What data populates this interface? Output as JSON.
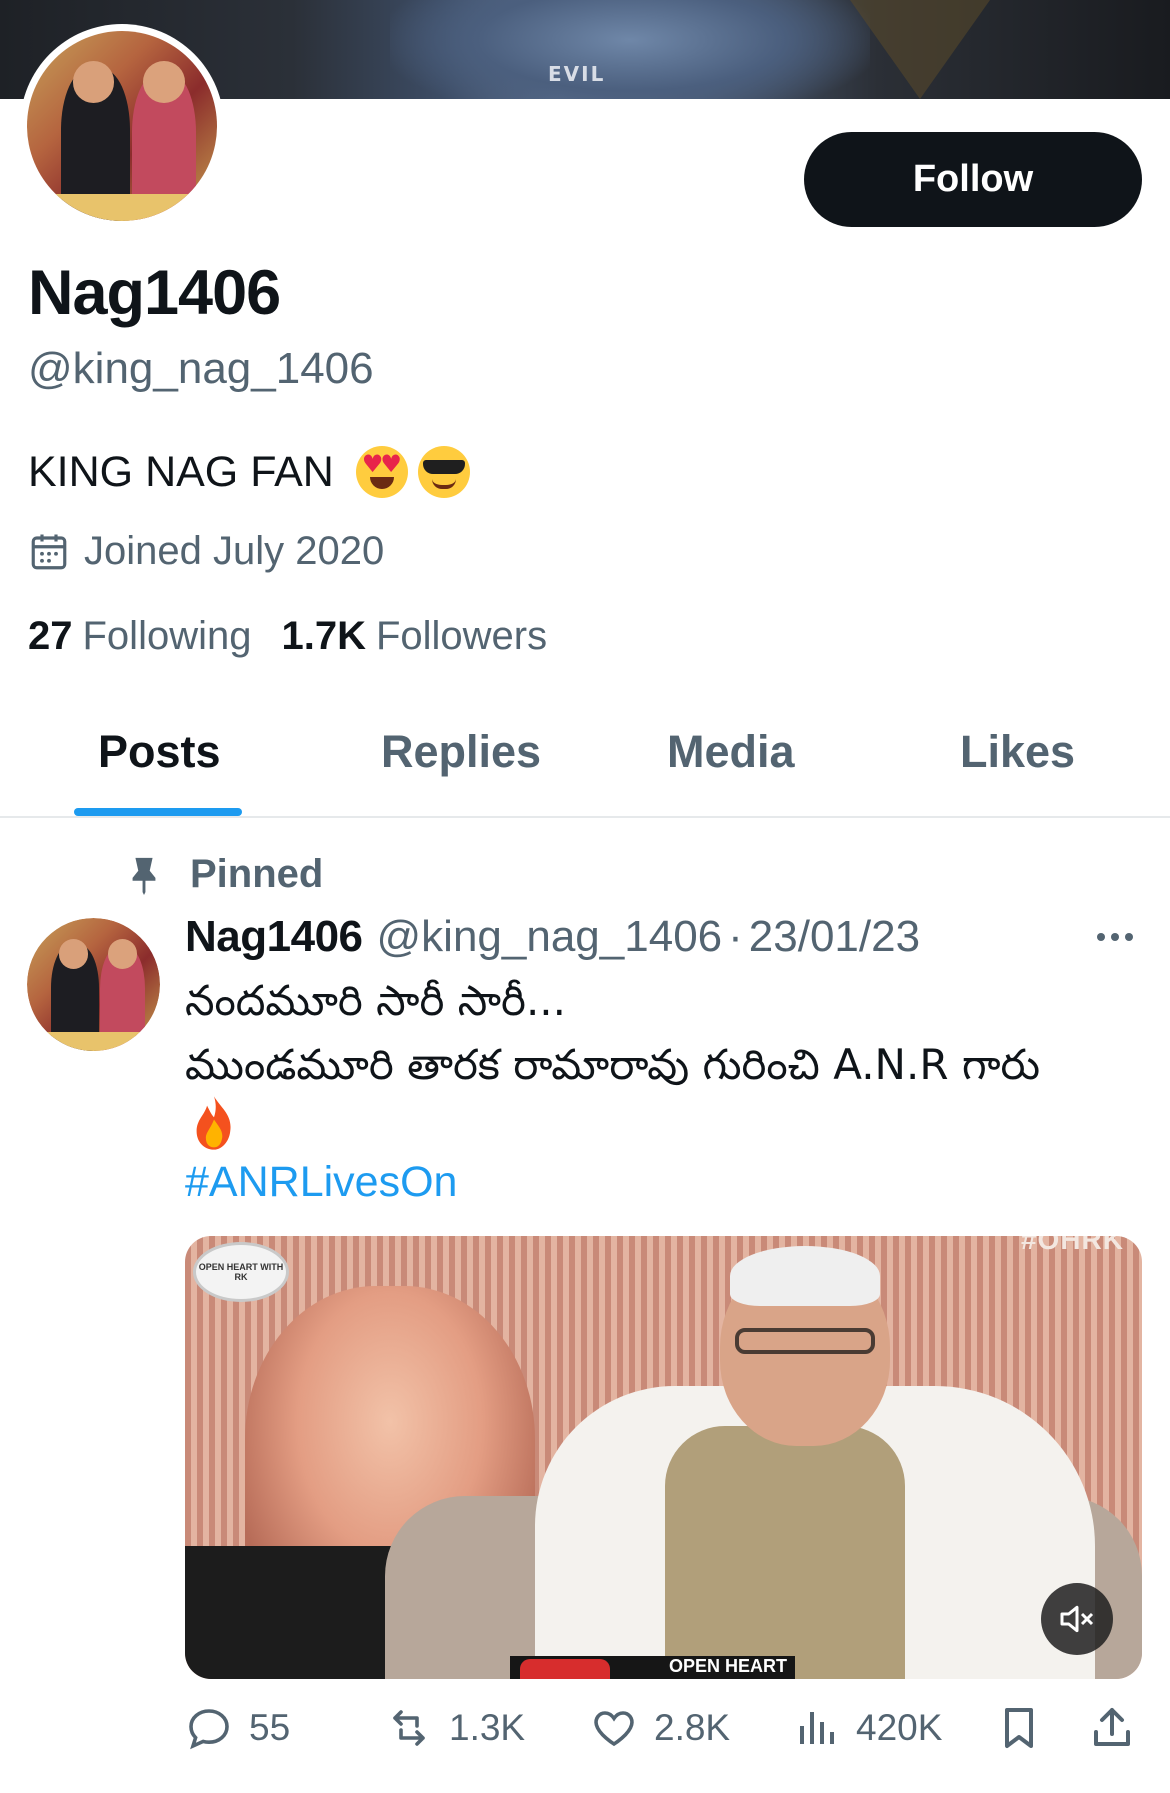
{
  "banner": {
    "text": "EVIL"
  },
  "profile": {
    "display_name": "Nag1406",
    "handle": "@king_nag_1406",
    "bio": "KING NAG FAN",
    "bio_emojis": [
      "heart-eyes-emoji",
      "sunglasses-emoji"
    ],
    "joined": "Joined July 2020",
    "following_count": "27",
    "following_label": "Following",
    "followers_count": "1.7K",
    "followers_label": "Followers",
    "follow_button": "Follow"
  },
  "tabs": [
    {
      "label": "Posts",
      "active": true
    },
    {
      "label": "Replies",
      "active": false
    },
    {
      "label": "Media",
      "active": false
    },
    {
      "label": "Likes",
      "active": false
    }
  ],
  "post": {
    "pinned_label": "Pinned",
    "author_name": "Nag1406",
    "author_handle": "@king_nag_1406",
    "separator": "·",
    "date": "23/01/23",
    "text_line1": "నందమూరి సారీ సారీ...",
    "text_line2": "ముండమూరి తారక రామారావు గురించి A.N.R గారు",
    "emoji": "fire-emoji",
    "hashtag": "#ANRLivesOn",
    "media": {
      "overlay_top": "#OHRK",
      "logo_text": "OPEN HEART WITH RK",
      "bottom_text": "OPEN HEART",
      "muted": true
    },
    "actions": {
      "replies": "55",
      "reposts": "1.3K",
      "likes": "2.8K",
      "views": "420K"
    }
  },
  "colors": {
    "accent": "#1d9bf0",
    "text_primary": "#0f1419",
    "text_secondary": "#536471",
    "button_bg": "#0f1419"
  }
}
